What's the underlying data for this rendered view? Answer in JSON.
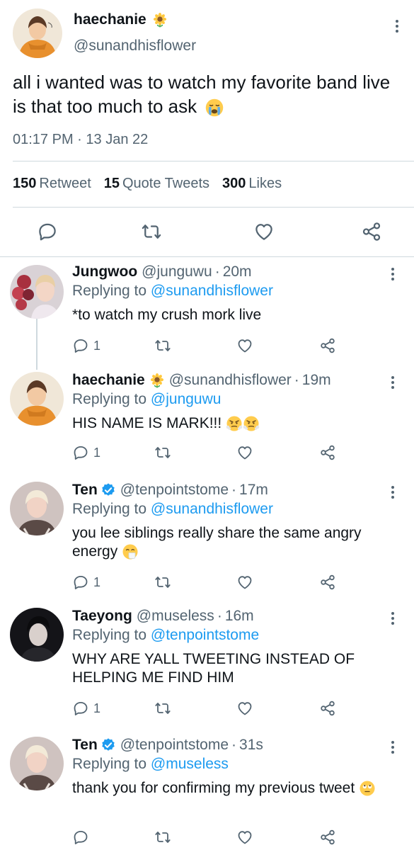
{
  "main_tweet": {
    "name": "haechanie",
    "handle": "@sunandhisflower",
    "text": "all i wanted was to watch my favorite band live is that too much to ask",
    "time": "01:17 PM",
    "date": "13 Jan 22",
    "retweets": {
      "count": "150",
      "label": "Retweet"
    },
    "quotes": {
      "count": "15",
      "label": "Quote Tweets"
    },
    "likes": {
      "count": "300",
      "label": "Likes"
    }
  },
  "replies": [
    {
      "name": "Jungwoo",
      "handle": "@junguwu",
      "age": "20m",
      "replying_label": "Replying to",
      "replying_to": "@sunandhisflower",
      "text": "*to watch my crush mork live",
      "reply_count": "1"
    },
    {
      "name": "haechanie",
      "handle": "@sunandhisflower",
      "age": "19m",
      "replying_label": "Replying to",
      "replying_to": "@junguwu",
      "text": "HIS NAME IS MARK!!!",
      "reply_count": "1"
    },
    {
      "name": "Ten",
      "handle": "@tenpointstome",
      "age": "17m",
      "replying_label": "Replying to",
      "replying_to": "@sunandhisflower",
      "text": "you lee siblings really share the same angry energy",
      "reply_count": "1"
    },
    {
      "name": "Taeyong",
      "handle": "@museless",
      "age": "16m",
      "replying_label": "Replying to",
      "replying_to": "@tenpointstome",
      "text": "WHY ARE YALL TWEETING INSTEAD OF HELPING ME FIND HIM",
      "reply_count": "1"
    },
    {
      "name": "Ten",
      "handle": "@tenpointstome",
      "age": "31s",
      "replying_label": "Replying to",
      "replying_to": "@museless",
      "text": "thank you for confirming my previous tweet",
      "reply_count": ""
    }
  ],
  "separator": "·",
  "icons": {
    "reply": "reply-icon",
    "retweet": "retweet-icon",
    "like": "like-icon",
    "share": "share-icon",
    "more": "more-icon",
    "verified": "verified-badge-icon",
    "sunflower": "sunflower-emoji",
    "crying": "crying-emoji",
    "angry": "angry-emoji",
    "sneeze": "sneezing-emoji",
    "eyeroll": "eyeroll-emoji"
  },
  "colors": {
    "text": "#0f1419",
    "secondary": "#536471",
    "link": "#1d9bf0",
    "divider": "#cfd9de",
    "verified": "#1d9bf0"
  }
}
